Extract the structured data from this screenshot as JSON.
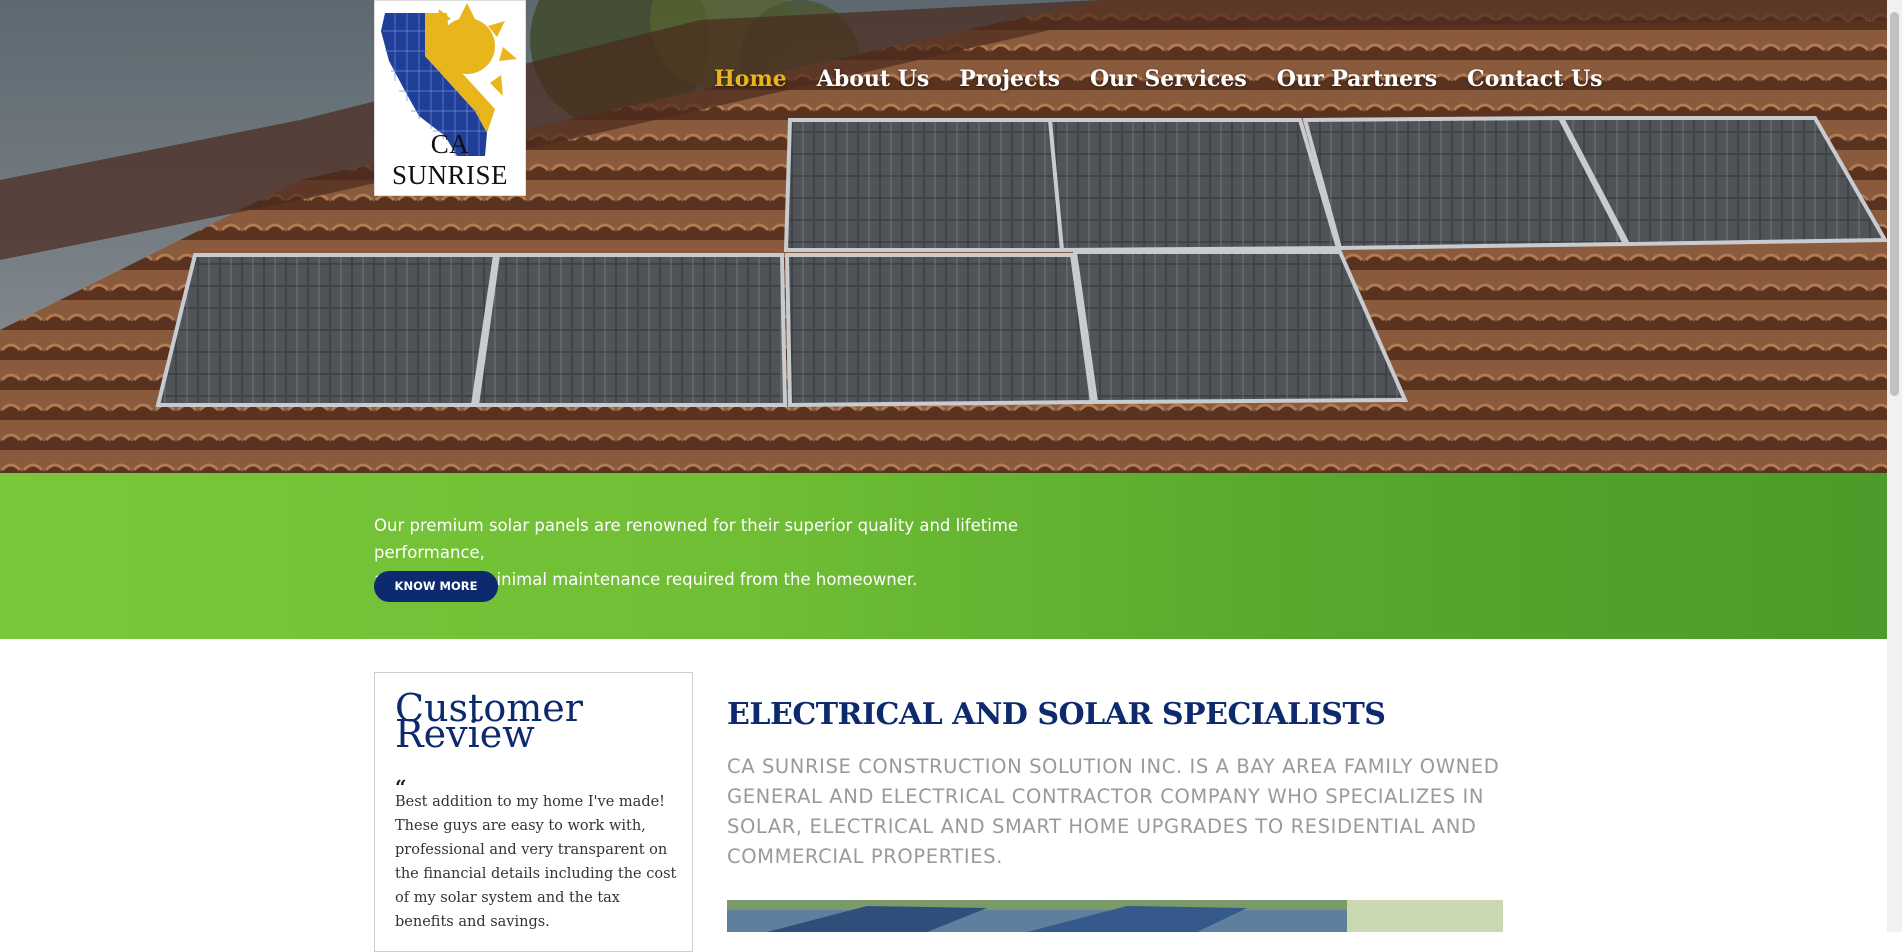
{
  "logo": {
    "text": "CA SUNRISE"
  },
  "nav": {
    "items": [
      "Home",
      "About Us",
      "Projects",
      "Our Services",
      "Our Partners",
      "Contact Us"
    ],
    "active": "Home"
  },
  "band": {
    "line1": "Our premium solar panels are renowned for their superior quality and lifetime performance,",
    "line2": "all with very minimal maintenance required from the homeowner.",
    "button": "KNOW MORE"
  },
  "review": {
    "title": "Customer Review",
    "quote_mark": "“",
    "text": "Best addition to my home I've made! These guys are easy to work with, professional and very transparent on the financial details including the cost of my solar system and the tax benefits and savings."
  },
  "main": {
    "heading": "ELECTRICAL AND SOLAR SPECIALISTS",
    "description": "CA SUNRISE CONSTRUCTION SOLUTION INC. IS A BAY AREA FAMILY OWNED GENERAL AND ELECTRICAL CONTRACTOR COMPANY WHO SPECIALIZES IN SOLAR, ELECTRICAL AND SMART HOME UPGRADES TO RESIDENTIAL AND COMMERCIAL PROPERTIES."
  },
  "colors": {
    "brand_navy": "#0e2a6e",
    "nav_active": "#e8b51c",
    "band_green": "#6fbe34"
  }
}
